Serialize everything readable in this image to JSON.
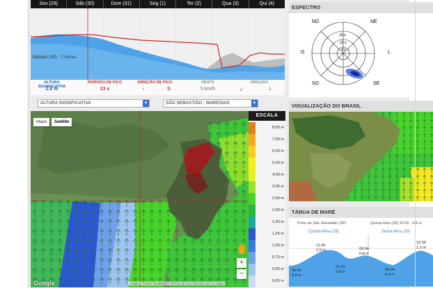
{
  "forecast": {
    "days": [
      "Sex (29)",
      "Sáb (30)",
      "Dom (31)",
      "Seg (1)",
      "Ter (2)",
      "Qua (3)",
      "Qui (4)"
    ],
    "cursor_label": "Sábado (30) - 7 horas",
    "stats": [
      {
        "label": "ALTURA SIGNIFICATIVA",
        "value": "2.8 m",
        "color": "#1e5fc0"
      },
      {
        "label": "PERÍODO DE PICO",
        "value": "13 s",
        "color": "#c62828"
      },
      {
        "label": "DIREÇÃO DE PICO",
        "value": "S",
        "color": "#c62828"
      },
      {
        "label": "VENTO",
        "value": "5 km/h",
        "color": "#666666"
      },
      {
        "label": "DIREÇÃO",
        "value": "L",
        "color": "#666666"
      }
    ]
  },
  "controls": {
    "variable": "ALTURA SIGNIFICATIVA",
    "location": "SÃO SEBASTIÃO - MARESIAS"
  },
  "map": {
    "toggle_map": "Mapa",
    "toggle_satellite": "Satélite",
    "zoom_in": "+",
    "zoom_out": "−",
    "google": "Google",
    "attribution": "Imagens ©2016 TerraMetrics   Termos de Uso   Informar erro no mapa"
  },
  "scale": {
    "title": "ESCALA",
    "items": [
      {
        "label": "8,00 m",
        "color": "#e08020"
      },
      {
        "label": "7,00 m",
        "color": "#f5a623"
      },
      {
        "label": "6,00 m",
        "color": "#f5cf23"
      },
      {
        "label": "5,00 m",
        "color": "#f5ee23"
      },
      {
        "label": "4,00 m",
        "color": "#e5f02a"
      },
      {
        "label": "3,00 m",
        "color": "#9be02a"
      },
      {
        "label": "2,50 m",
        "color": "#49d32a"
      },
      {
        "label": "2,00 m",
        "color": "#2ab73a"
      },
      {
        "label": "1,50 m",
        "color": "#1fa8a0"
      },
      {
        "label": "1,25 m",
        "color": "#2b57d0"
      },
      {
        "label": "1,00 m",
        "color": "#3b7ae0"
      },
      {
        "label": "0,75 m",
        "color": "#6fa0ea"
      },
      {
        "label": "0,50 m",
        "color": "#9fc2f0"
      },
      {
        "label": "0,25 m",
        "color": "#c9dcf5"
      }
    ]
  },
  "spectrum": {
    "title": "ESPECTRO",
    "directions": [
      "NO",
      "NE",
      "O",
      "L",
      "SO",
      "SE"
    ],
    "rings": [
      "15 s",
      "10 s",
      "5 s"
    ]
  },
  "brazil": {
    "title": "VISUALIZAÇÃO DO BRASIL"
  },
  "tide": {
    "title": "TÁBUA DE MARÉ",
    "port": "Porto de São Sebastião (SP)",
    "summary": "Quinta-feira (28) 22:00 - 0.8 m",
    "day_left": "Quinta-feira (28)",
    "day_right": "Sexta-feira (29)",
    "points": [
      {
        "time": "00:56",
        "height": "0.4 m"
      },
      {
        "time": "11:43",
        "height": "1.0 m"
      },
      {
        "time": "16:19",
        "height": "0.8 m"
      },
      {
        "time": "00:04",
        "height": "0.8 m"
      },
      {
        "time": "05:04",
        "height": "0.4 m"
      },
      {
        "time": "12:36",
        "height": "1.1 m"
      }
    ]
  }
}
